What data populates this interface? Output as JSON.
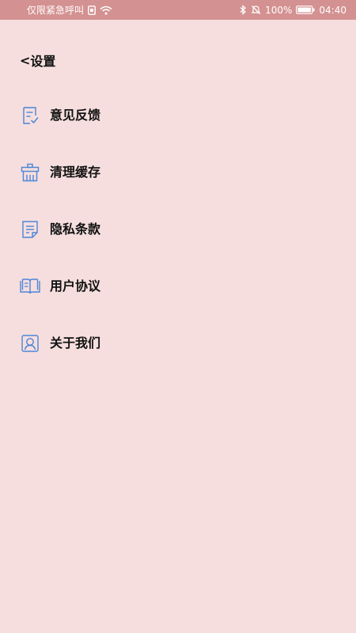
{
  "status_bar": {
    "carrier": "仅限紧急呼叫",
    "battery": "100%",
    "time": "04:40",
    "icons": [
      "sim-icon",
      "wifi-icon",
      "bluetooth-icon",
      "mute-icon",
      "battery-icon"
    ]
  },
  "header": {
    "back": "<",
    "title": "设置"
  },
  "menu": {
    "items": [
      {
        "label": "意见反馈",
        "icon": "feedback-icon"
      },
      {
        "label": "清理缓存",
        "icon": "clear-cache-icon"
      },
      {
        "label": "隐私条款",
        "icon": "privacy-icon"
      },
      {
        "label": "用户协议",
        "icon": "agreement-icon"
      },
      {
        "label": "关于我们",
        "icon": "about-icon"
      }
    ]
  },
  "colors": {
    "background": "#f6dede",
    "status_bar": "#d49191",
    "icon_accent": "#4a86d8"
  }
}
